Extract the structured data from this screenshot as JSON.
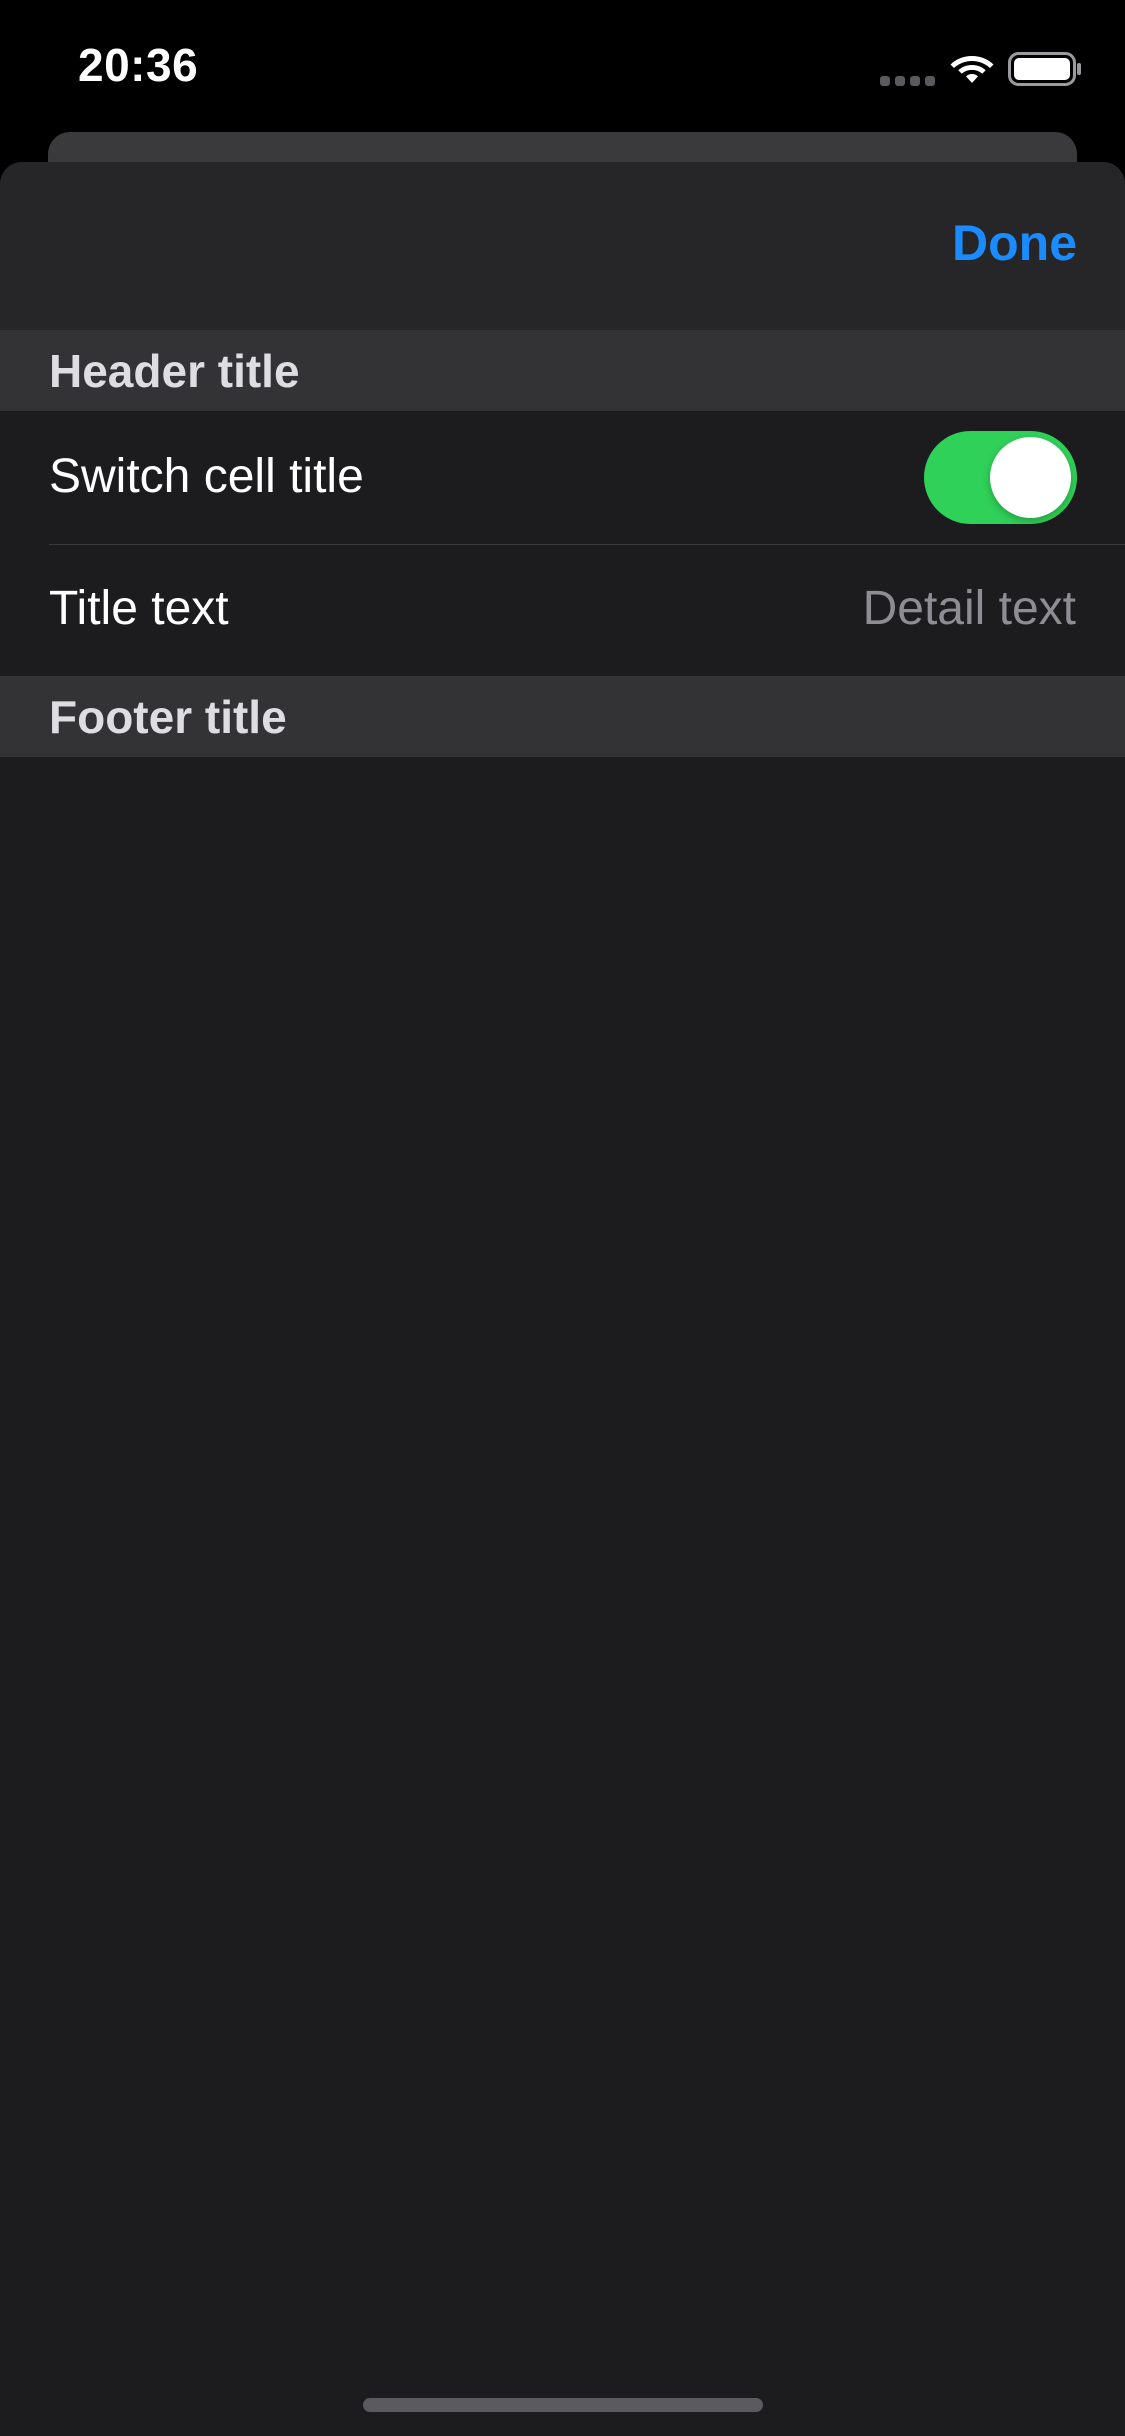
{
  "status_bar": {
    "time": "20:36",
    "icons": [
      "cellular-signal-icon",
      "wifi-icon",
      "battery-icon"
    ]
  },
  "nav_bar": {
    "done_label": "Done"
  },
  "sections": {
    "header_title": "Header title",
    "footer_title": "Footer title"
  },
  "cells": {
    "switch_cell": {
      "title": "Switch cell title",
      "switch_on": true
    },
    "detail_cell": {
      "title": "Title text",
      "detail": "Detail text"
    }
  },
  "colors": {
    "accent": "#1a8cff",
    "switch_on": "#30d158",
    "background": "#1c1c1e",
    "section_background": "#333336"
  }
}
